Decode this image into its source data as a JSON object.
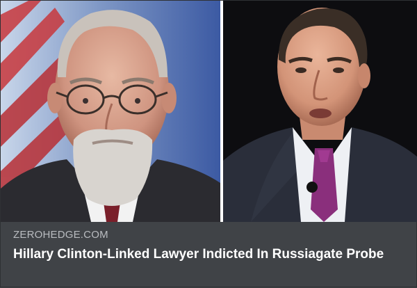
{
  "article": {
    "source": "ZEROHEDGE.COM",
    "headline": "Hillary Clinton-Linked Lawyer Indicted In Russiagate Probe"
  },
  "colors": {
    "card_background": "#404347",
    "source_text": "#b9bcc0",
    "headline_text": "#ffffff",
    "divider": "#ffffff"
  }
}
